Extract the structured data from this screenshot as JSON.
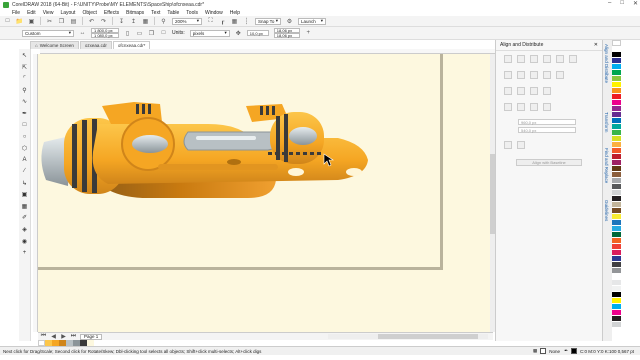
{
  "window": {
    "title": "CorelDRAW 2018 (64-Bit) - F:\\UNITY\\Probe\\MY ELEMENTS\\SpaceShip\\ofcnxeaa.cdr*",
    "controls": [
      "–",
      "□",
      "✕"
    ]
  },
  "menu": [
    "File",
    "Edit",
    "View",
    "Layout",
    "Object",
    "Effects",
    "Bitmaps",
    "Text",
    "Table",
    "Tools",
    "Window",
    "Help"
  ],
  "toolbar": {
    "zoom": "200%",
    "snap_to": "Snap To",
    "launch": "Launch"
  },
  "property_bar": {
    "preset": "Custom",
    "width": "1 800,0 px",
    "height": "1 080,0 px",
    "units_label": "Units:",
    "units": "pixels",
    "nudge": "10,0 px",
    "dup_x": "18,06 px",
    "dup_y": "18,06 px"
  },
  "tabs": [
    {
      "label": "Welcome Screen"
    },
    {
      "label": "ozxeaa.cdr"
    },
    {
      "label": "ofcnxeaa.cdr*"
    }
  ],
  "page_nav": {
    "page": "Page 1"
  },
  "docker": {
    "title": "Align and Distribute",
    "field_w": "960,0 px",
    "field_h": "540,0 px",
    "button": "Align with Baseline"
  },
  "side_tabs": [
    "Align and Distribute",
    "Transform",
    "Find and Replace",
    "Guidelines"
  ],
  "status": {
    "hint": "Next click for Drag/Scale; Second click for Rotate/Skew; Dbl-clicking tool selects all objects; Shift+click multi-selects; Alt+click digs",
    "fill": "None",
    "color_info": "C:0 M:0 Y:0 K:100  0,567 pt"
  },
  "colors": {
    "hull_main": "#f5a623",
    "hull_dark": "#c97a10",
    "hull_light": "#fcc64a",
    "metal": "#b8c0c4",
    "canvas_bg": "#fdf8df"
  }
}
